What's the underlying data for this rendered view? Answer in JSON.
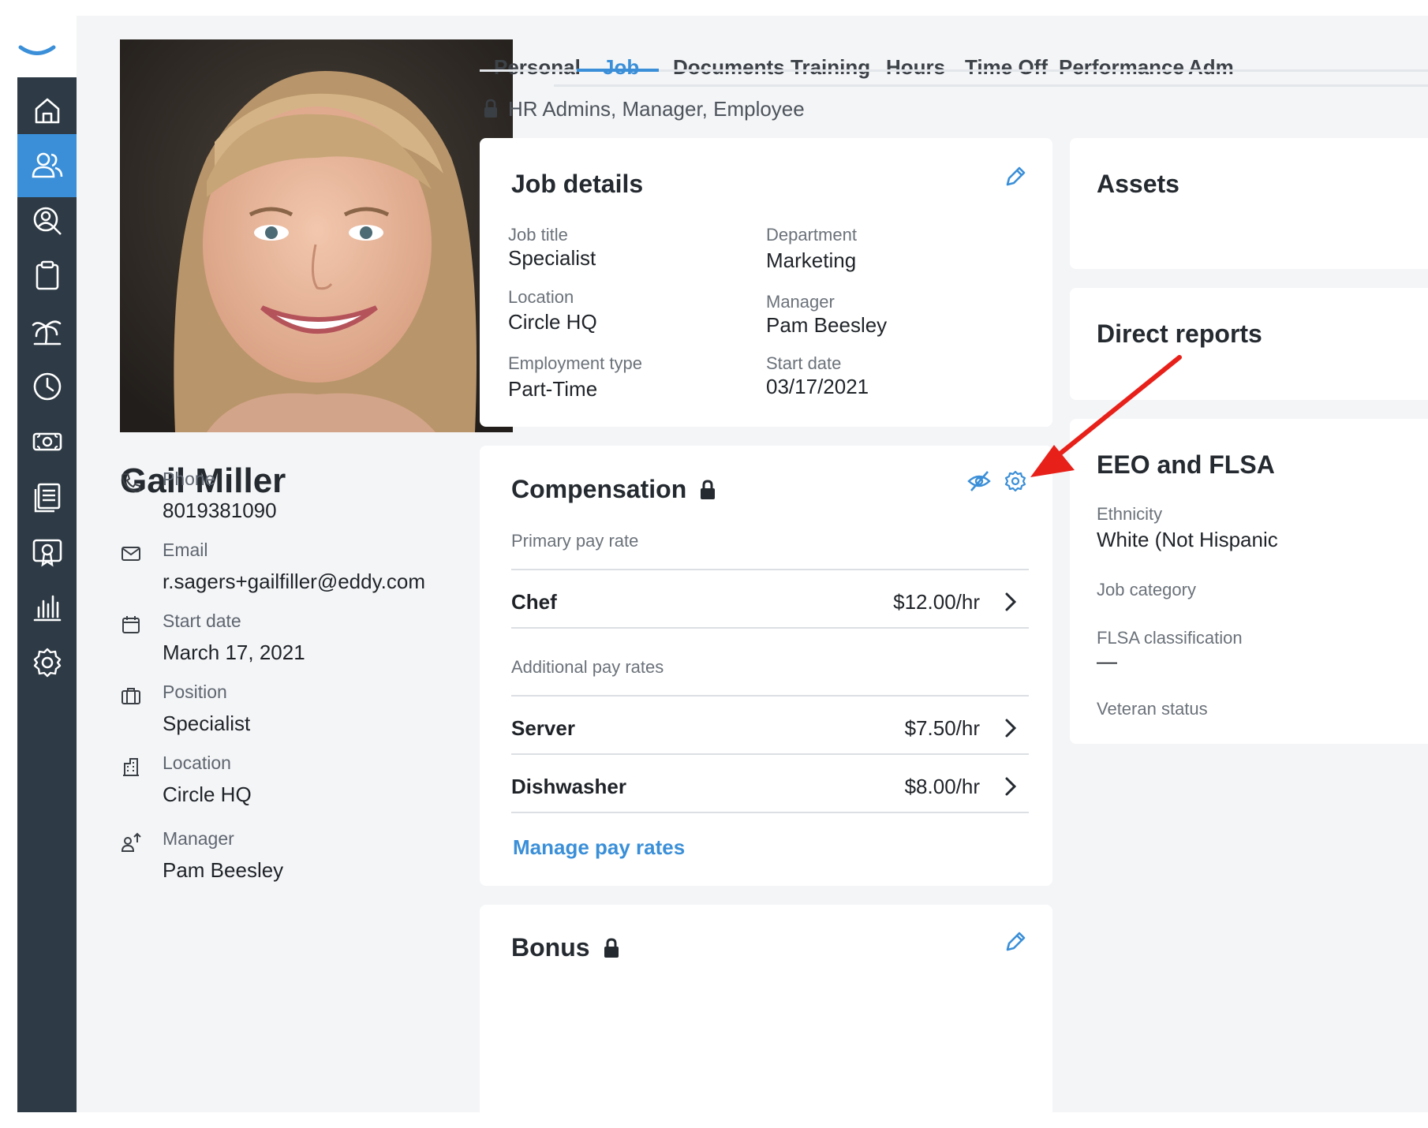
{
  "profile": {
    "name": "Gail Miller",
    "fields": [
      {
        "label": "Phone",
        "value": "8019381090",
        "icon": "phone-icon"
      },
      {
        "label": "Email",
        "value": "r.sagers+gailfiller@eddy.com",
        "icon": "mail-icon"
      },
      {
        "label": "Start date",
        "value": "March 17, 2021",
        "icon": "calendar-icon"
      },
      {
        "label": "Position",
        "value": "Specialist",
        "icon": "briefcase-icon"
      },
      {
        "label": "Location",
        "value": "Circle HQ",
        "icon": "building-icon"
      },
      {
        "label": "Manager",
        "value": "Pam Beesley",
        "icon": "manager-icon"
      }
    ]
  },
  "tabs": [
    "Personal",
    "Job",
    "Documents",
    "Training",
    "Hours",
    "Time Off",
    "Performance",
    "Adm"
  ],
  "active_tab": "Job",
  "access_text": "HR Admins, Manager, Employee",
  "job_details": {
    "title": "Job details",
    "fields": [
      {
        "label": "Job title",
        "value": "Specialist"
      },
      {
        "label": "Department",
        "value": "Marketing"
      },
      {
        "label": "Location",
        "value": "Circle HQ"
      },
      {
        "label": "Manager",
        "value": "Pam Beesley"
      },
      {
        "label": "Employment type",
        "value": "Part-Time"
      },
      {
        "label": "Start date",
        "value": "03/17/2021"
      }
    ]
  },
  "compensation": {
    "title": "Compensation",
    "primary_label": "Primary pay rate",
    "primary": {
      "name": "Chef",
      "rate": "$12.00/hr"
    },
    "additional_label": "Additional pay rates",
    "additional": [
      {
        "name": "Server",
        "rate": "$7.50/hr"
      },
      {
        "name": "Dishwasher",
        "rate": "$8.00/hr"
      }
    ],
    "manage_link": "Manage pay rates"
  },
  "bonus": {
    "title": "Bonus"
  },
  "right_cards": {
    "assets_title": "Assets",
    "direct_reports_title": "Direct reports",
    "eeo_title": "EEO and FLSA",
    "eeo_fields": [
      {
        "label": "Ethnicity",
        "value": "White (Not Hispanic"
      },
      {
        "label": "Job category",
        "value": ""
      },
      {
        "label": "FLSA classification",
        "value": "—"
      },
      {
        "label": "Veteran status",
        "value": ""
      }
    ]
  },
  "colors": {
    "accent": "#3a8fd8",
    "nav": "#2e3a45",
    "annotation_arrow": "#e8201a"
  }
}
